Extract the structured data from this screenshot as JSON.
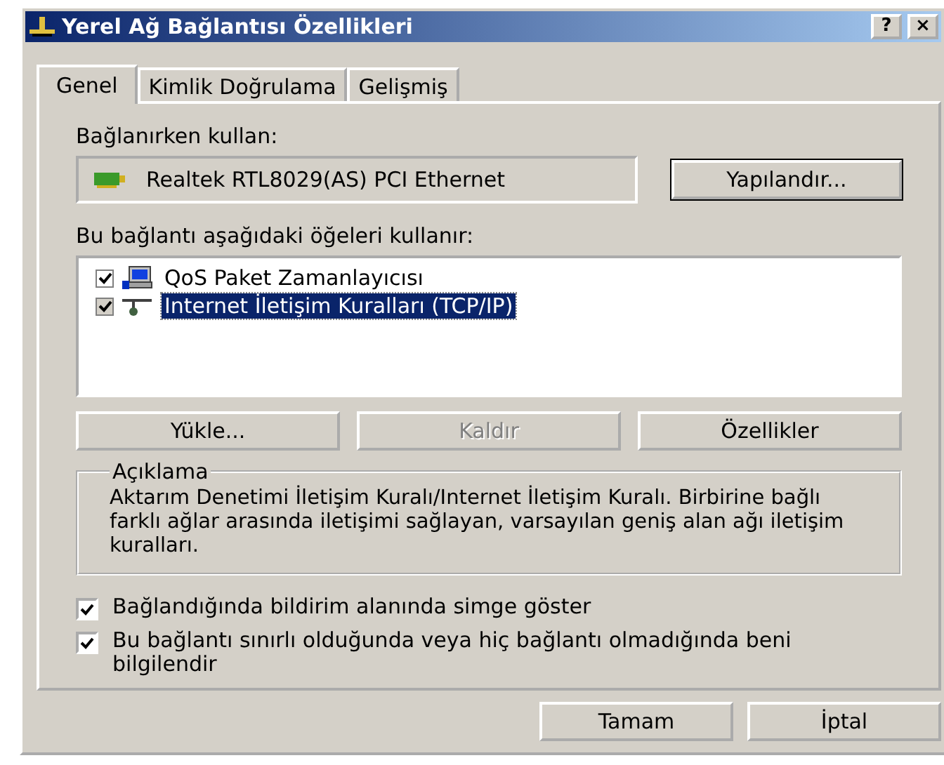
{
  "window": {
    "title": "Yerel Ağ Bağlantısı Özellikleri",
    "help_button": "?",
    "close_button": "×"
  },
  "tabs": [
    {
      "label": "Genel",
      "selected": true
    },
    {
      "label": "Kimlik Doğrulama",
      "selected": false
    },
    {
      "label": "Gelişmiş",
      "selected": false
    }
  ],
  "connect_using": {
    "label": "Bağlanırken kullan:",
    "adapter": "Realtek RTL8029(AS) PCI Ethernet",
    "button": "Yapılandır..."
  },
  "components": {
    "label": "Bu bağlantı aşağıdaki öğeleri kullanır:",
    "items": [
      {
        "label": "QoS Paket Zamanlayıcısı",
        "kind": "scheduler",
        "checked": true,
        "selected": false
      },
      {
        "label": "Internet İletişim Kuralları (TCP/IP)",
        "kind": "protocol",
        "checked": true,
        "selected": true
      }
    ]
  },
  "component_buttons": [
    {
      "label": "Yükle...",
      "disabled": false
    },
    {
      "label": "Kaldır",
      "disabled": true
    },
    {
      "label": "Özellikler",
      "disabled": false
    }
  ],
  "description": {
    "title": "Açıklama",
    "text": "Aktarım Denetimi İletişim Kuralı/Internet İletişim Kuralı. Birbirine bağlı farklı ağlar arasında iletişimi sağlayan, varsayılan geniş alan ağı iletişim kuralları."
  },
  "options": [
    {
      "label": "Bağlandığında bildirim alanında simge göster",
      "checked": true
    },
    {
      "label": "Bu bağlantı sınırlı olduğunda veya hiç bağlantı olmadığında beni bilgilendir",
      "checked": true
    }
  ],
  "buttons": [
    "Tamam",
    "İptal"
  ]
}
